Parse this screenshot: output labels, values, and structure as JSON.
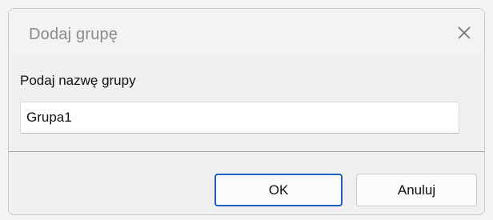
{
  "dialog": {
    "title": "Dodaj grupę",
    "close_icon": "close-icon",
    "prompt_label": "Podaj nazwę grupy",
    "group_name_value": "Grupa1",
    "buttons": {
      "ok_label": "OK",
      "cancel_label": "Anuluj"
    },
    "colors": {
      "accent": "#1f5fbf",
      "title_text": "#8a8a8a",
      "background": "#f0f0f0"
    }
  }
}
